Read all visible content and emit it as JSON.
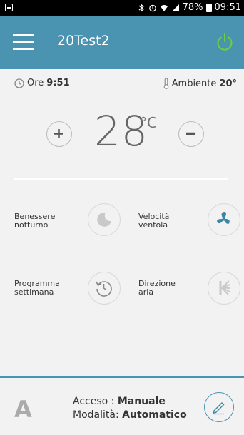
{
  "status_bar": {
    "battery": "78%",
    "time": "09:51"
  },
  "header": {
    "title": "20Test2"
  },
  "info": {
    "time_label": "Ore",
    "time_value": "9:51",
    "ambient_label": "Ambiente",
    "ambient_value": "20°"
  },
  "temperature": {
    "value": "28",
    "unit": "°C"
  },
  "controls": {
    "night_comfort": [
      "Benessere",
      "notturno"
    ],
    "fan_speed": [
      "Velocità",
      "ventola"
    ],
    "week_program": [
      "Programma",
      "settimana"
    ],
    "air_direction": [
      "Direzione",
      "aria"
    ]
  },
  "footer": {
    "mode_letter": "A",
    "acceso_label": "Acceso :",
    "acceso_value": "Manuale",
    "modalita_label": "Modalità:",
    "modalita_value": "Automatico"
  },
  "colors": {
    "header": "#4a93b1",
    "power": "#6ad13a",
    "icon_blue": "#3e86a6"
  }
}
